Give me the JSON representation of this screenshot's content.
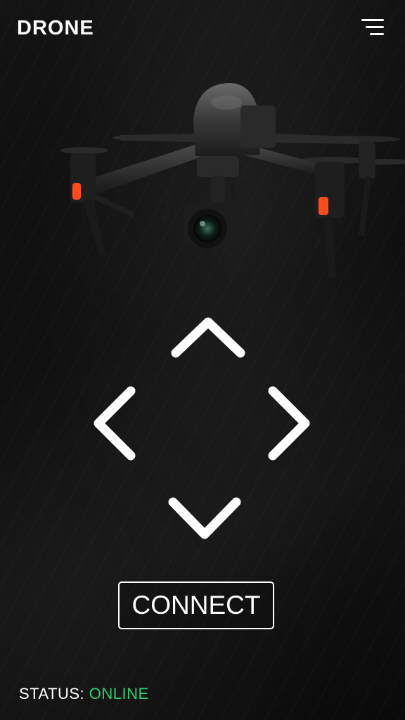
{
  "app": {
    "logo": "DRONE"
  },
  "header": {
    "menu_icon": "hamburger-menu-icon"
  },
  "controls": {
    "up_icon": "chevron-up-icon",
    "left_icon": "chevron-left-icon",
    "right_icon": "chevron-right-icon",
    "down_icon": "chevron-down-icon",
    "connect_label": "CONNECT"
  },
  "status": {
    "label": "STATUS:",
    "value": "ONLINE",
    "value_color": "#2ecc71"
  },
  "colors": {
    "background": "#0d0d0d",
    "foreground": "#ffffff",
    "accent_orange": "#ff4a1c"
  }
}
